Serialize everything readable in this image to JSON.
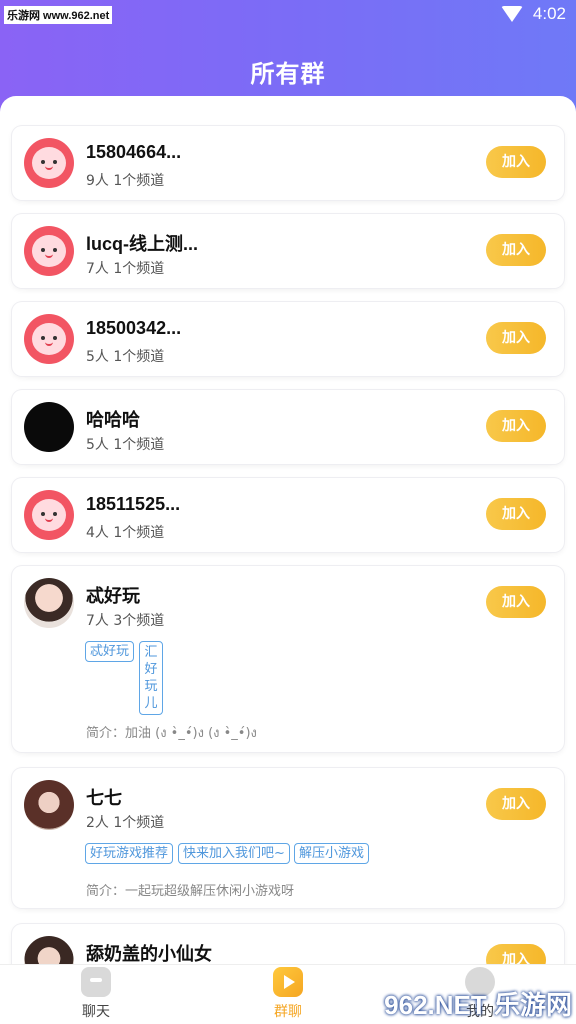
{
  "status": {
    "watermark": "乐游网 www.962.net",
    "time": "4:02"
  },
  "header": {
    "title": "所有群"
  },
  "join_label": "加入",
  "groups": [
    {
      "name": "15804664...",
      "meta": "9人 1个频道",
      "avatar": "pink-face-icon"
    },
    {
      "name": "lucq-线上测...",
      "meta": "7人 1个频道",
      "avatar": "pink-face-icon"
    },
    {
      "name": "18500342...",
      "meta": "5人 1个频道",
      "avatar": "pink-face-icon"
    },
    {
      "name": "哈哈哈",
      "meta": "5人 1个频道",
      "avatar": "black-avatar"
    },
    {
      "name": "18511525...",
      "meta": "4人 1个频道",
      "avatar": "pink-face-icon"
    },
    {
      "name": "忒好玩",
      "meta": "7人 3个频道",
      "avatar": "photo-avatar",
      "tags": [
        "忒好玩",
        "汇好玩儿"
      ],
      "intro": "简介：加油 (ง •̀_•́)ง (ง •̀_•́)ง"
    },
    {
      "name": "七七",
      "meta": "2人 1个频道",
      "avatar": "photo-avatar",
      "tags": [
        "好玩游戏推荐",
        "快来加入我们吧~",
        "解压小游戏"
      ],
      "intro": "简介：一起玩超级解压休闲小游戏呀"
    },
    {
      "name": "舔奶盖的小仙女",
      "meta": "",
      "avatar": "photo-avatar"
    }
  ],
  "tabs": [
    {
      "label": "聊天",
      "icon": "chat-icon"
    },
    {
      "label": "群聊",
      "icon": "group-chat-icon",
      "active": true
    },
    {
      "label": "我的",
      "icon": "profile-icon"
    }
  ],
  "footer_watermark": "962.NET 乐游网"
}
